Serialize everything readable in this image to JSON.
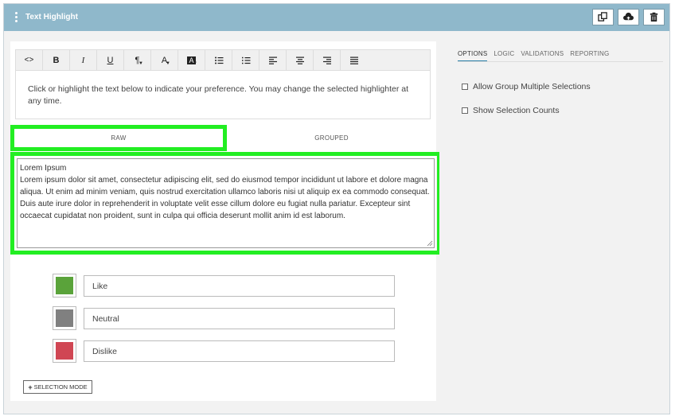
{
  "header": {
    "title": "Text Highlight",
    "buttons": [
      "copy-icon",
      "cloud-upload-icon",
      "trash-icon"
    ]
  },
  "toolbar": {
    "items": [
      "<>",
      "B",
      "I",
      "U",
      "¶",
      "A",
      "A",
      "bulleted-list-icon",
      "numbered-list-icon",
      "align-left-icon",
      "align-center-icon",
      "align-right-icon",
      "justify-icon"
    ]
  },
  "instructions": "Click or highlight the text below to indicate your preference. You may change the selected highlighter at any time.",
  "tabs": {
    "raw": "RAW",
    "grouped": "GROUPED"
  },
  "text": {
    "title": "Lorem Ipsum",
    "body": "Lorem ipsum dolor sit amet, consectetur adipiscing elit, sed do eiusmod tempor incididunt ut labore et dolore magna aliqua. Ut enim ad minim veniam, quis nostrud exercitation ullamco laboris nisi ut aliquip ex ea commodo consequat. Duis aute irure dolor in reprehenderit in voluptate velit esse cillum dolore eu fugiat nulla pariatur. Excepteur sint occaecat cupidatat non proident, sunt in culpa qui officia deserunt mollit anim id est laborum."
  },
  "highlighters": [
    {
      "label": "Like",
      "color": "#5aa33a"
    },
    {
      "label": "Neutral",
      "color": "#808080"
    },
    {
      "label": "Dislike",
      "color": "#d04653"
    }
  ],
  "selection_mode": "SELECTION MODE",
  "right_tabs": [
    "OPTIONS",
    "LOGIC",
    "VALIDATIONS",
    "REPORTING"
  ],
  "options": [
    "Allow Group Multiple Selections",
    "Show Selection Counts"
  ],
  "colors": {
    "header": "#8fb8cb",
    "highlight_border": "#22ee22"
  }
}
